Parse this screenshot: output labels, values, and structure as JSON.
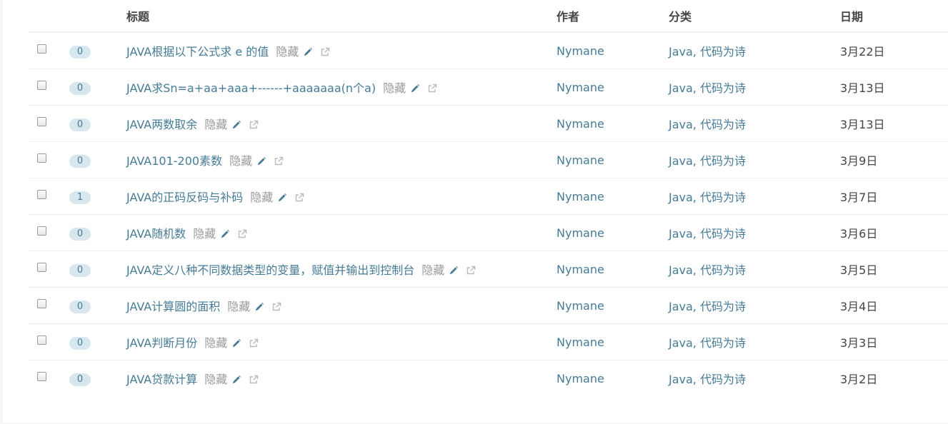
{
  "headers": {
    "title": "标题",
    "author": "作者",
    "category": "分类",
    "date": "日期"
  },
  "hidden_label": "隐藏",
  "icons": {
    "edit": "pencil-icon",
    "external": "external-link-icon"
  },
  "colors": {
    "link": "#467b96",
    "badge_bg": "#d8e7ee",
    "muted": "#999999",
    "header_text": "#444444"
  },
  "posts": [
    {
      "comments": "0",
      "title": "JAVA根据以下公式求 e 的值",
      "author": "Nymane",
      "category": "Java, 代码为诗",
      "date": "3月22日"
    },
    {
      "comments": "0",
      "title": "JAVA求Sn=a+aa+aaa+------+aaaaaaa(n个a)",
      "author": "Nymane",
      "category": "Java, 代码为诗",
      "date": "3月13日"
    },
    {
      "comments": "0",
      "title": "JAVA两数取余",
      "author": "Nymane",
      "category": "Java, 代码为诗",
      "date": "3月13日"
    },
    {
      "comments": "0",
      "title": "JAVA101-200素数",
      "author": "Nymane",
      "category": "Java, 代码为诗",
      "date": "3月9日"
    },
    {
      "comments": "1",
      "title": "JAVA的正码反码与补码",
      "author": "Nymane",
      "category": "Java, 代码为诗",
      "date": "3月7日"
    },
    {
      "comments": "0",
      "title": "JAVA随机数",
      "author": "Nymane",
      "category": "Java, 代码为诗",
      "date": "3月6日"
    },
    {
      "comments": "0",
      "title": "JAVA定义八种不同数据类型的变量，赋值并输出到控制台",
      "author": "Nymane",
      "category": "Java, 代码为诗",
      "date": "3月5日"
    },
    {
      "comments": "0",
      "title": "JAVA计算圆的面积",
      "author": "Nymane",
      "category": "Java, 代码为诗",
      "date": "3月4日"
    },
    {
      "comments": "0",
      "title": "JAVA判断月份",
      "author": "Nymane",
      "category": "Java, 代码为诗",
      "date": "3月3日"
    },
    {
      "comments": "0",
      "title": "JAVA贷款计算",
      "author": "Nymane",
      "category": "Java, 代码为诗",
      "date": "3月2日"
    }
  ]
}
